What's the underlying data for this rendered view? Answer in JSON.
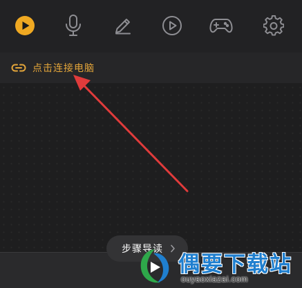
{
  "toolbar": {
    "items": [
      {
        "name": "play-circle-icon",
        "active": true,
        "color": "#f0a922"
      },
      {
        "name": "microphone-icon",
        "active": false
      },
      {
        "name": "pencil-icon",
        "active": false
      },
      {
        "name": "play-outline-icon",
        "active": false
      },
      {
        "name": "gamepad-icon",
        "active": false
      },
      {
        "name": "gear-icon",
        "active": false
      }
    ],
    "icon_color": "#8e8e93"
  },
  "connect": {
    "icon": "link-icon",
    "label": "点击连接电脑",
    "color": "#e3a53a"
  },
  "annotation": {
    "icon": "red-arrow",
    "color": "#e03b3b"
  },
  "step_guide": {
    "label": "步骤导读",
    "icon": "chevron-right-icon"
  },
  "watermark": {
    "brand": "偶要下载站",
    "url": "ouyaoxiazai.com"
  }
}
